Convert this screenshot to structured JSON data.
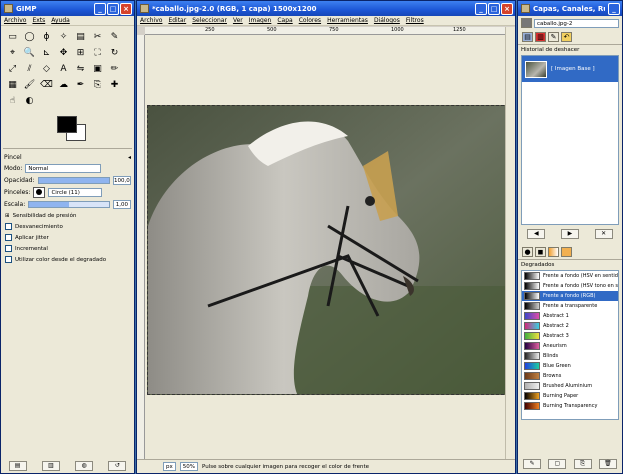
{
  "toolbox": {
    "title": "GIMP",
    "menu": [
      "Archivo",
      "Exts",
      "Ayuda"
    ],
    "tools": [
      "rect-select-icon",
      "ellipse-select-icon",
      "lasso-icon",
      "fuzzy-select-icon",
      "color-select-icon",
      "scissors-icon",
      "paths-icon",
      "color-picker-icon",
      "zoom-icon",
      "measure-icon",
      "move-icon",
      "align-icon",
      "crop-icon",
      "rotate-icon",
      "scale-icon",
      "shear-icon",
      "perspective-icon",
      "text-icon",
      "flip-icon",
      "bucket-fill-icon",
      "pencil-icon",
      "blend-icon",
      "paintbrush-icon",
      "eraser-icon",
      "airbrush-icon",
      "ink-icon",
      "clone-icon",
      "heal-icon",
      "smudge-icon",
      "dodge-burn-icon"
    ],
    "tool_glyphs": [
      "▭",
      "◯",
      "ɸ",
      "✧",
      "▤",
      "✂",
      "✎",
      "⌖",
      "🔍",
      "⊾",
      "✥",
      "⊞",
      "⛶",
      "↻",
      "⤢",
      "⫽",
      "◇",
      "A",
      "⇋",
      "▣",
      "✏",
      "▦",
      "🖌",
      "⌫",
      "☁",
      "✒",
      "⎘",
      "✚",
      "☝",
      "◐"
    ],
    "options": {
      "title": "Pincel",
      "mode_label": "Modo:",
      "mode_value": "Normal",
      "opacity_label": "Opacidad:",
      "opacity_value": "100,0",
      "opacity_fraction": 1.0,
      "brushes_label": "Pinceles:",
      "brush_value": "Circle (11)",
      "scale_label": "Escala:",
      "scale_value": "1,00",
      "scale_fraction": 0.5,
      "pressure_label": "Sensibilidad de presión",
      "checks": [
        "Desvanecimiento",
        "Aplicar jitter",
        "Incremental",
        "Utilizar color desde el degradado"
      ]
    }
  },
  "image_window": {
    "title": "*caballo.jpg-2.0 (RGB, 1 capa) 1500x1200",
    "menu": [
      "Archivo",
      "Editar",
      "Seleccionar",
      "Ver",
      "Imagen",
      "Capa",
      "Colores",
      "Herramientas",
      "Diálogos",
      "Filtros"
    ],
    "ruler_ticks": [
      "250",
      "500",
      "750",
      "1000",
      "1250"
    ],
    "status": {
      "unit": "px",
      "zoom": "50%",
      "message": "Pulse sobre cualquier imagen para recoger el color de frente"
    }
  },
  "dock": {
    "title": "Capas, Canales, Rutas...",
    "image_combo": "caballo.jpg-2",
    "undo_title": "Historial de deshacer",
    "undo_items": [
      "[ Imagen Base ]"
    ],
    "gradients_title": "Degradados",
    "gradients": [
      {
        "name": "Frente a fondo (HSV en sentido an",
        "c1": "#000000",
        "c2": "#ffffff"
      },
      {
        "name": "Frente a fondo (HSV tono en sentio",
        "c1": "#000000",
        "c2": "#ffffff"
      },
      {
        "name": "Frente a fondo (RGB)",
        "c1": "#000000",
        "c2": "#ffffff"
      },
      {
        "name": "Frente a transparente",
        "c1": "#000000",
        "c2": "#cccccc"
      },
      {
        "name": "Abstract 1",
        "c1": "#3a47c8",
        "c2": "#e04da8"
      },
      {
        "name": "Abstract 2",
        "c1": "#d02a7a",
        "c2": "#3ad0e0"
      },
      {
        "name": "Abstract 3",
        "c1": "#40b040",
        "c2": "#f0e040"
      },
      {
        "name": "Aneurism",
        "c1": "#200040",
        "c2": "#e060a0"
      },
      {
        "name": "Blinds",
        "c1": "#222222",
        "c2": "#eeeeee"
      },
      {
        "name": "Blue Green",
        "c1": "#2040e0",
        "c2": "#20d0a0"
      },
      {
        "name": "Browns",
        "c1": "#6b3a1a",
        "c2": "#c08040"
      },
      {
        "name": "Brushed Aluminium",
        "c1": "#b0b0b0",
        "c2": "#f0f0f0"
      },
      {
        "name": "Burning Paper",
        "c1": "#000000",
        "c2": "#f0a020"
      },
      {
        "name": "Burning Transparency",
        "c1": "#400000",
        "c2": "#f08020"
      }
    ]
  }
}
